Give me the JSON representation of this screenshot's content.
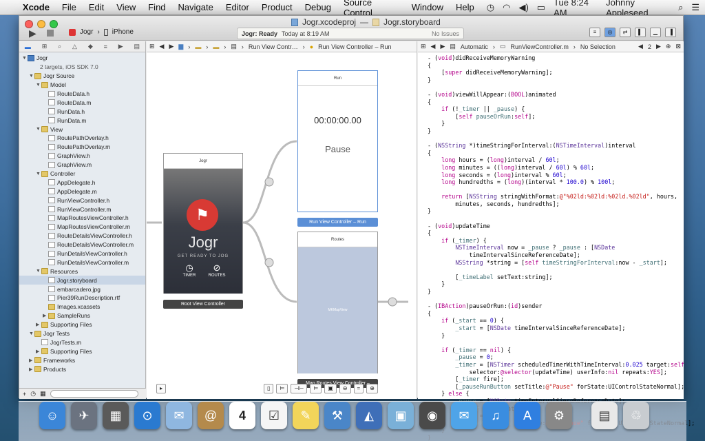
{
  "menubar": {
    "items": [
      "Xcode",
      "File",
      "Edit",
      "View",
      "Find",
      "Navigate",
      "Editor",
      "Product",
      "Debug",
      "Source Control",
      "Window",
      "Help"
    ],
    "time": "Tue 8:24 AM",
    "user": "Johnny Appleseed"
  },
  "window": {
    "project_file": "Jogr.xcodeproj",
    "separator": "—",
    "storyboard_file": "Jogr.storyboard",
    "scheme_target": "Jogr",
    "scheme_device": "iPhone",
    "activity_status": "Jogr: Ready",
    "activity_time": "Today at 8:19 AM",
    "activity_issues": "No Issues"
  },
  "navigator": {
    "rows": [
      {
        "label": "Jogr",
        "indent": 0,
        "type": "proj",
        "tri": "▼"
      },
      {
        "label": "2 targets, iOS SDK 7.0",
        "indent": 0,
        "type": "sub",
        "tri": ""
      },
      {
        "label": "Jogr Source",
        "indent": 1,
        "type": "folder",
        "tri": "▼"
      },
      {
        "label": "Model",
        "indent": 2,
        "type": "folder",
        "tri": "▼"
      },
      {
        "label": "RouteData.h",
        "indent": 3,
        "type": "file",
        "tri": ""
      },
      {
        "label": "RouteData.m",
        "indent": 3,
        "type": "file",
        "tri": ""
      },
      {
        "label": "RunData.h",
        "indent": 3,
        "type": "file",
        "tri": ""
      },
      {
        "label": "RunData.m",
        "indent": 3,
        "type": "file",
        "tri": ""
      },
      {
        "label": "View",
        "indent": 2,
        "type": "folder",
        "tri": "▼"
      },
      {
        "label": "RoutePathOverlay.h",
        "indent": 3,
        "type": "file",
        "tri": ""
      },
      {
        "label": "RoutePathOverlay.m",
        "indent": 3,
        "type": "file",
        "tri": ""
      },
      {
        "label": "GraphView.h",
        "indent": 3,
        "type": "file",
        "tri": ""
      },
      {
        "label": "GraphView.m",
        "indent": 3,
        "type": "file",
        "tri": ""
      },
      {
        "label": "Controller",
        "indent": 2,
        "type": "folder",
        "tri": "▼"
      },
      {
        "label": "AppDelegate.h",
        "indent": 3,
        "type": "file",
        "tri": ""
      },
      {
        "label": "AppDelegate.m",
        "indent": 3,
        "type": "file",
        "tri": ""
      },
      {
        "label": "RunViewController.h",
        "indent": 3,
        "type": "file",
        "tri": ""
      },
      {
        "label": "RunViewController.m",
        "indent": 3,
        "type": "file",
        "tri": ""
      },
      {
        "label": "MapRoutesViewController.h",
        "indent": 3,
        "type": "file",
        "tri": ""
      },
      {
        "label": "MapRoutesViewController.m",
        "indent": 3,
        "type": "file",
        "tri": ""
      },
      {
        "label": "RouteDetailsViewController.h",
        "indent": 3,
        "type": "file",
        "tri": ""
      },
      {
        "label": "RouteDetailsViewController.m",
        "indent": 3,
        "type": "file",
        "tri": ""
      },
      {
        "label": "RunDetailsViewController.h",
        "indent": 3,
        "type": "file",
        "tri": ""
      },
      {
        "label": "RunDetailsViewController.m",
        "indent": 3,
        "type": "file",
        "tri": ""
      },
      {
        "label": "Resources",
        "indent": 2,
        "type": "folder",
        "tri": "▼"
      },
      {
        "label": "Jogr.storyboard",
        "indent": 3,
        "type": "file",
        "tri": "",
        "selected": true
      },
      {
        "label": "embarcadero.jpg",
        "indent": 3,
        "type": "file",
        "tri": ""
      },
      {
        "label": "Pier39RunDescription.rtf",
        "indent": 3,
        "type": "file",
        "tri": ""
      },
      {
        "label": "Images.xcassets",
        "indent": 3,
        "type": "folder",
        "tri": ""
      },
      {
        "label": "SampleRuns",
        "indent": 3,
        "type": "folder",
        "tri": "▶"
      },
      {
        "label": "Supporting Files",
        "indent": 2,
        "type": "folder",
        "tri": "▶"
      },
      {
        "label": "Jogr Tests",
        "indent": 1,
        "type": "folder",
        "tri": "▼"
      },
      {
        "label": "JogrTests.m",
        "indent": 2,
        "type": "file",
        "tri": ""
      },
      {
        "label": "Supporting Files",
        "indent": 2,
        "type": "folder",
        "tri": "▶"
      },
      {
        "label": "Frameworks",
        "indent": 1,
        "type": "folder",
        "tri": "▶"
      },
      {
        "label": "Products",
        "indent": 1,
        "type": "folder",
        "tri": "▶"
      }
    ]
  },
  "canvas": {
    "jump_items": [
      "Run View Contr…",
      "Run View Controller – Run"
    ],
    "run_title": "Run",
    "timer": "00:00:00.00",
    "pause": "Pause",
    "run_label": "Run View Controller – Run",
    "routes_title": "Routes",
    "map_label": "MKMapView",
    "map_ctrl_label": "Map Routes View Controller –",
    "root_title": "Jogr",
    "root_brand": "Jogr",
    "root_tagline": "GET READY TO JOG",
    "timer_btn": "TIMER",
    "routes_btn": "ROUTES",
    "root_label": "Root View Controller"
  },
  "editor": {
    "jump_automatic": "Automatic",
    "jump_file": "RunViewController.m",
    "jump_selection": "No Selection",
    "jump_counter": "2"
  },
  "dock": {
    "icons": [
      "finder-icon",
      "launchpad-icon",
      "mission-control-icon",
      "safari-icon",
      "mail-icon",
      "contacts-icon",
      "calendar-icon",
      "reminders-icon",
      "notes-icon",
      "xcode-icon",
      "instruments-icon",
      "preview-icon",
      "facetime-icon",
      "messages-icon",
      "itunes-icon",
      "app-store-icon",
      "system-preferences-icon",
      "documents-icon",
      "trash-icon"
    ],
    "calendar_day": "4"
  }
}
